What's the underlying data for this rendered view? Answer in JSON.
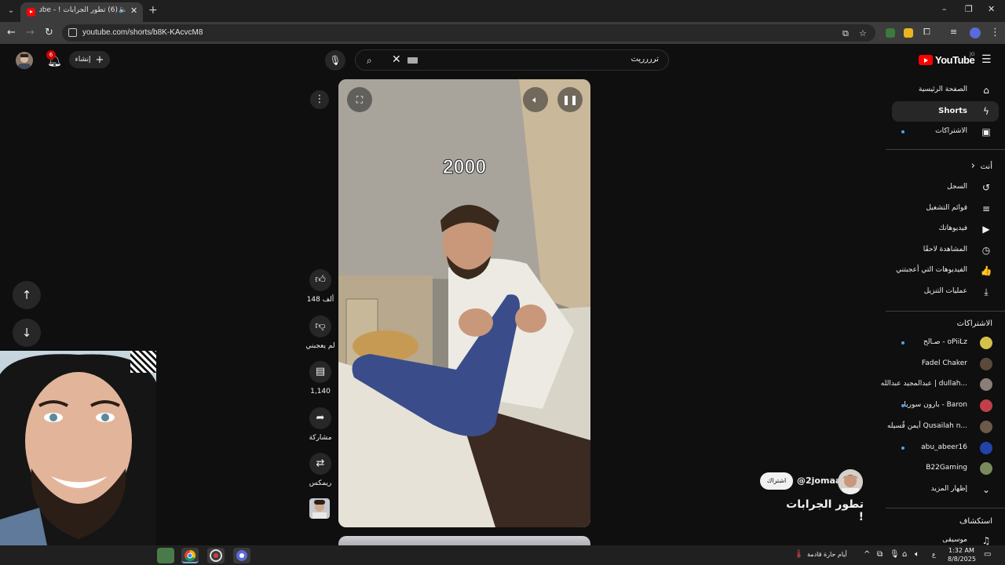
{
  "browser": {
    "tab_title": "(6) تطور الجرابات ! - YouTube",
    "url": "youtube.com/shorts/b8K-KAcvcM8",
    "new_tab": "+",
    "window_controls": {
      "minimize": "–",
      "restore": "❐",
      "close": "✕"
    }
  },
  "header": {
    "notifications_count": "6",
    "create_label": "إنشاء",
    "search_value": "ترررريت",
    "logo_text": "YouTube",
    "country_code": "JO"
  },
  "player": {
    "overlay_text": "2000"
  },
  "actions": {
    "like_count": "148 ألف",
    "dislike_label": "لم يعجبني",
    "comments_count": "1,140",
    "share_label": "مشاركة",
    "remix_label": "ريمكس"
  },
  "channel": {
    "subscribe_label": "اشتراك",
    "handle": "@2jomaa",
    "short_title": "تطور الجرابات !"
  },
  "sidebar": {
    "main": [
      {
        "label": "الصفحة الرئيسية",
        "icon": "home-icon",
        "glyph": "⌂"
      },
      {
        "label": "Shorts",
        "icon": "shorts-icon",
        "glyph": "ϟ"
      },
      {
        "label": "الاشتراكات",
        "icon": "subscriptions-icon",
        "glyph": "▣"
      }
    ],
    "you_header": "أنت",
    "you": [
      {
        "label": "السجل",
        "icon": "history-icon",
        "glyph": "↺"
      },
      {
        "label": "قوائم التشغيل",
        "icon": "playlists-icon",
        "glyph": "≡"
      },
      {
        "label": "فيديوهاتك",
        "icon": "your-videos-icon",
        "glyph": "▶"
      },
      {
        "label": "المشاهدة لاحقًا",
        "icon": "watch-later-icon",
        "glyph": "◷"
      },
      {
        "label": "الفيديوهات التي أعجبتني",
        "icon": "liked-videos-icon",
        "glyph": "👍"
      },
      {
        "label": "عمليات التنزيل",
        "icon": "downloads-icon",
        "glyph": "⤓"
      }
    ],
    "subs_header": "الاشتراكات",
    "subscriptions": [
      {
        "label": "صـالح - oPiiLz",
        "color": "#d4c14a",
        "dot": true
      },
      {
        "label": "Fadel Chaker",
        "color": "#5a4a3c",
        "dot": false
      },
      {
        "label": "عبدالمجيد عبدالله | dullah...",
        "color": "#8a7f78",
        "dot": false
      },
      {
        "label": "بارون سوريا - Baron",
        "color": "#c0404a",
        "dot": true
      },
      {
        "label": "أيمن قُسيله Qusailah n...",
        "color": "#6b5a48",
        "dot": false
      },
      {
        "label": "abu_abeer16",
        "color": "#2244aa",
        "dot": true
      },
      {
        "label": "B22Gaming",
        "color": "#7a8a5a",
        "dot": false
      }
    ],
    "show_more": "إظهار المزيد",
    "explore_header": "استكشاف",
    "explore_first": "موسيقى"
  },
  "taskbar": {
    "weather_text": "أيام حارة قادمة",
    "lang": "ع",
    "time": "1:32 AM",
    "date": "8/8/2025"
  }
}
